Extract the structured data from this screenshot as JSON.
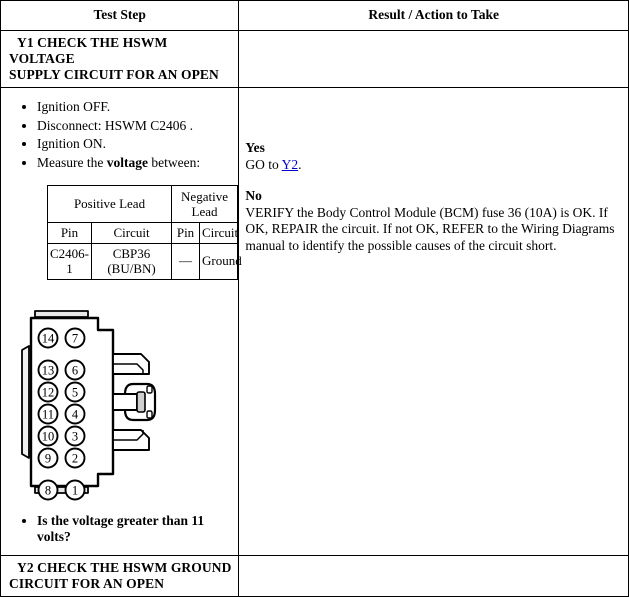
{
  "table": {
    "headers": {
      "test_step": "Test Step",
      "result_action": "Result / Action to Take"
    }
  },
  "step_y1": {
    "title_line1": "Y1 CHECK THE HSWM VOLTAGE",
    "title_line2": "SUPPLY CIRCUIT FOR AN OPEN",
    "bullets": [
      "Ignition OFF.",
      "Disconnect: HSWM C2406 .",
      "Ignition ON."
    ],
    "measure_prefix": "Measure the ",
    "measure_bold": "voltage",
    "measure_suffix": " between:",
    "question": "Is the voltage greater than 11 volts?",
    "lead_table": {
      "group_positive": "Positive Lead",
      "group_negative": "Negative Lead",
      "col_pin": "Pin",
      "col_circuit": "Circuit",
      "row": {
        "positive_pin": "C2406-1",
        "positive_circuit_line1": "CBP36",
        "positive_circuit_line2": "(BU/BN)",
        "negative_pin": "—",
        "negative_circuit": "Ground"
      }
    },
    "connector": {
      "name": "hswm-c2406-connector",
      "pins_left": [
        "14",
        "13",
        "12",
        "11",
        "10",
        "9",
        "8"
      ],
      "pins_right": [
        "7",
        "6",
        "5",
        "4",
        "3",
        "2",
        "1"
      ]
    },
    "result": {
      "yes_label": "Yes",
      "yes_text_prefix": "GO to ",
      "yes_link": "Y2",
      "yes_text_suffix": ".",
      "no_label": "No",
      "no_text": "VERIFY the Body Control Module (BCM) fuse 36 (10A) is OK. If OK, REPAIR the circuit. If not OK, REFER to the Wiring Diagrams manual to identify the possible causes of the circuit short."
    }
  },
  "step_y2": {
    "title_line1": "Y2 CHECK THE HSWM GROUND",
    "title_line2": "CIRCUIT FOR AN OPEN"
  },
  "colors": {
    "link": "#0000cc",
    "border": "#000000",
    "background": "#ffffff"
  }
}
